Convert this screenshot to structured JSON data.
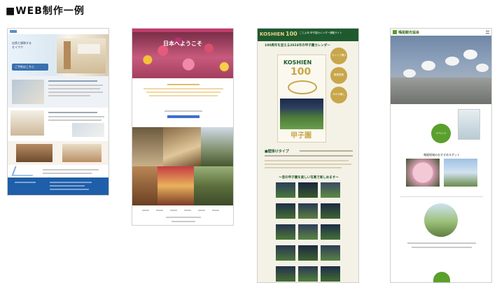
{
  "page": {
    "heading": "■WEB制作一例"
  },
  "site1": {
    "hero_text": "自然と調和する\nセイフク",
    "banner": "ご予約はこちら",
    "footer_color": "#1f5ea8"
  },
  "site2": {
    "hero_title": "日本へようこそ",
    "accent_color": "#c23a6b"
  },
  "site3": {
    "logo": "KOSHIEN",
    "logo_num": "100",
    "header_nav": "ことよめ 甲子園カレンダー通販サイト",
    "headline": "100周年を迎える2024年の甲子園カレンダー",
    "cover_logo": "KOSHIEN",
    "cover_num": "100",
    "cover_title": "甲子園",
    "badge_net": "ネットで購入",
    "badge_mail": "郵便振替",
    "badge_fax": "FAXで購入",
    "section_title": "■壁掛けタイプ",
    "gallery_title": "～昔の甲子園を美しい写真で楽しめます～",
    "brand_color": "#1e5a2e"
  },
  "site4": {
    "logo": "鳴尾観光協会",
    "badge": "イベント",
    "section": "鳴尾地域のおすすめスポット",
    "accent_color": "#5aa02c"
  }
}
